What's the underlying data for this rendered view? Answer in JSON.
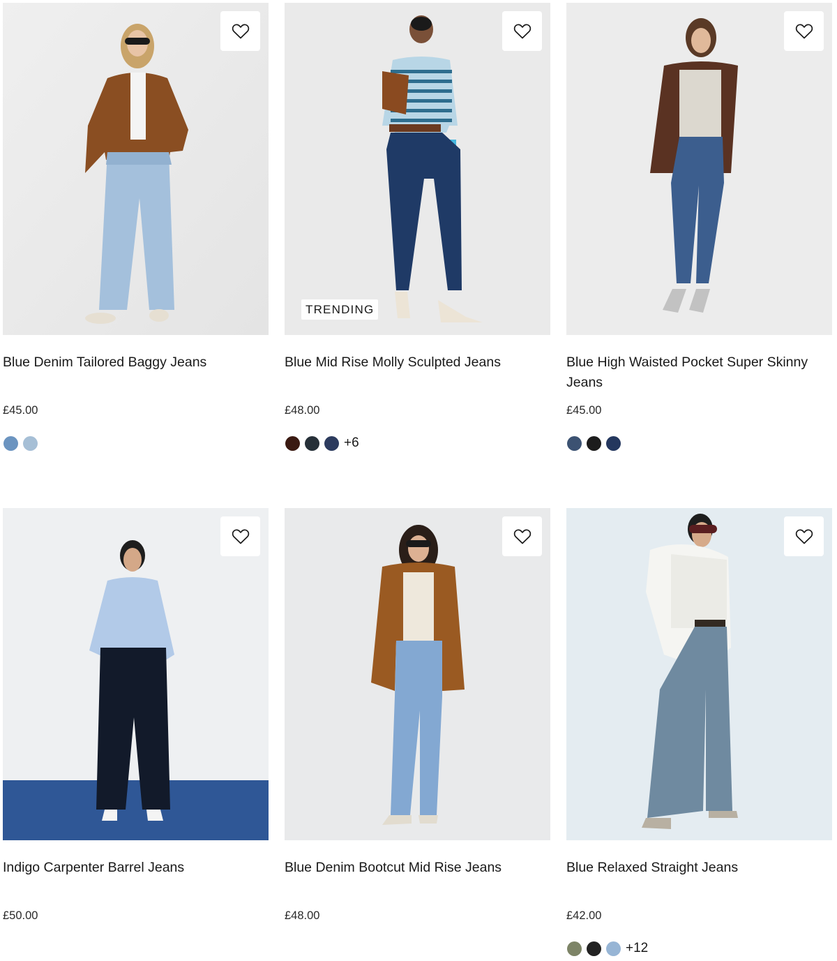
{
  "colors": {
    "text": "#1a1a1a",
    "wishlist_bg": "#ffffff",
    "image_bg": "#eeeeee"
  },
  "products": [
    {
      "title": "Blue Denim Tailored Baggy Jeans",
      "price": "£45.00",
      "badge": "",
      "wishlist_icon": "heart-outline-icon",
      "swatches": [
        "#6b94c0",
        "#a6bfd6"
      ],
      "more": ""
    },
    {
      "title": "Blue Mid Rise Molly Sculpted Jeans",
      "price": "£48.00",
      "badge": "TRENDING",
      "wishlist_icon": "heart-outline-icon",
      "swatches": [
        "#3a1a12",
        "#263038",
        "#2c3b5e"
      ],
      "more": "+6"
    },
    {
      "title": "Blue High Waisted Pocket Super Skinny Jeans",
      "price": "£45.00",
      "badge": "",
      "wishlist_icon": "heart-outline-icon",
      "swatches": [
        "#3c5272",
        "#1c1c1c",
        "#24375e"
      ],
      "more": ""
    },
    {
      "title": "Indigo Carpenter Barrel Jeans",
      "price": "£50.00",
      "badge": "",
      "wishlist_icon": "heart-outline-icon",
      "swatches": [],
      "more": ""
    },
    {
      "title": "Blue Denim Bootcut Mid Rise Jeans",
      "price": "£48.00",
      "badge": "",
      "wishlist_icon": "heart-outline-icon",
      "swatches": [],
      "more": ""
    },
    {
      "title": "Blue Relaxed Straight Jeans",
      "price": "£42.00",
      "badge": "",
      "wishlist_icon": "heart-outline-icon",
      "swatches": [
        "#7d8467",
        "#222222",
        "#97b5d5"
      ],
      "more": "+12"
    }
  ]
}
